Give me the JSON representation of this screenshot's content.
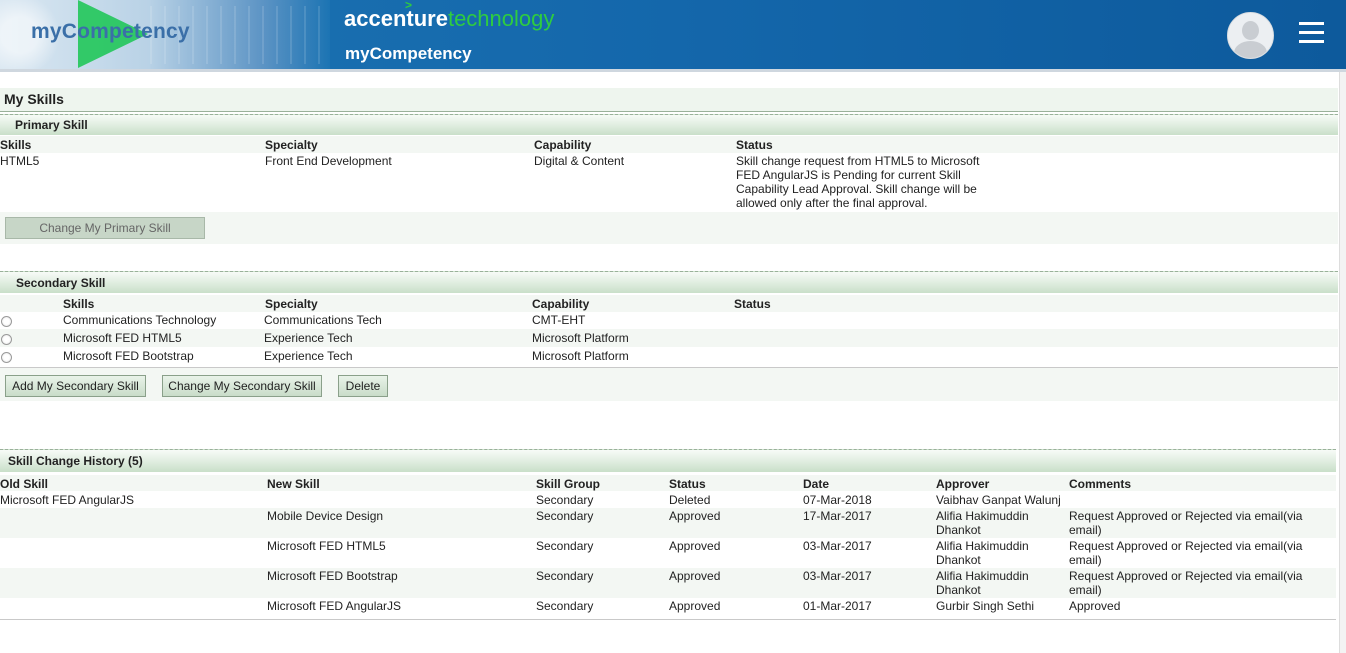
{
  "header": {
    "banner_text": "myCompetency",
    "brand_main": "accenture",
    "brand_tech": "technology",
    "brand_caret": ">",
    "subtitle": "myCompetency"
  },
  "page_title": "My Skills",
  "primary": {
    "title": "Primary Skill",
    "columns": [
      "Skills",
      "Specialty",
      "Capability",
      "Status"
    ],
    "row": {
      "skill": "HTML5",
      "specialty": "Front End Development",
      "capability": "Digital & Content",
      "status_lines": [
        "Skill change request from HTML5 to Microsoft",
        "FED AngularJS is Pending for current Skill",
        "Capability Lead Approval. Skill change will be",
        "allowed only after the final approval."
      ]
    },
    "change_button": "Change My Primary Skill"
  },
  "secondary": {
    "title": "Secondary Skill",
    "columns": [
      "Skills",
      "Specialty",
      "Capability",
      "Status"
    ],
    "rows": [
      {
        "skill": "Communications Technology",
        "specialty": "Communications Tech",
        "capability": "CMT-EHT",
        "status": ""
      },
      {
        "skill": "Microsoft FED HTML5",
        "specialty": "Experience Tech",
        "capability": "Microsoft Platform",
        "status": ""
      },
      {
        "skill": "Microsoft FED Bootstrap",
        "specialty": "Experience Tech",
        "capability": "Microsoft Platform",
        "status": ""
      }
    ],
    "buttons": {
      "add": "Add My Secondary Skill",
      "change": "Change My Secondary Skill",
      "delete": "Delete"
    }
  },
  "history": {
    "title": "Skill Change History (5)",
    "columns": [
      "Old Skill",
      "New Skill",
      "Skill Group",
      "Status",
      "Date",
      "Approver",
      "Comments"
    ],
    "rows": [
      {
        "old": "Microsoft FED AngularJS",
        "new": "",
        "group": "Secondary",
        "status": "Deleted",
        "date": "07-Mar-2018",
        "approver_1": "Vaibhav Ganpat Walunj",
        "approver_2": "",
        "comment_1": "",
        "comment_2": ""
      },
      {
        "old": "",
        "new": "Mobile Device Design",
        "group": "Secondary",
        "status": "Approved",
        "date": "17-Mar-2017",
        "approver_1": "Alifia Hakimuddin",
        "approver_2": "Dhankot",
        "comment_1": "Request Approved or Rejected via email(via",
        "comment_2": "email)"
      },
      {
        "old": "",
        "new": "Microsoft FED HTML5",
        "group": "Secondary",
        "status": "Approved",
        "date": "03-Mar-2017",
        "approver_1": "Alifia Hakimuddin",
        "approver_2": "Dhankot",
        "comment_1": "Request Approved or Rejected via email(via",
        "comment_2": "email)"
      },
      {
        "old": "",
        "new": "Microsoft FED Bootstrap",
        "group": "Secondary",
        "status": "Approved",
        "date": "03-Mar-2017",
        "approver_1": "Alifia Hakimuddin",
        "approver_2": "Dhankot",
        "comment_1": "Request Approved or Rejected via email(via",
        "comment_2": "email)"
      },
      {
        "old": "",
        "new": "Microsoft FED AngularJS",
        "group": "Secondary",
        "status": "Approved",
        "date": "01-Mar-2017",
        "approver_1": "Gurbir Singh Sethi",
        "approver_2": "",
        "comment_1": "Approved",
        "comment_2": ""
      }
    ]
  },
  "colors": {
    "header_blue": "#1467ab",
    "accent_green": "#2ecc40",
    "section_green": "#dcebdc"
  },
  "icons": {
    "avatar": "user-avatar-icon",
    "menu": "hamburger-menu-icon"
  }
}
